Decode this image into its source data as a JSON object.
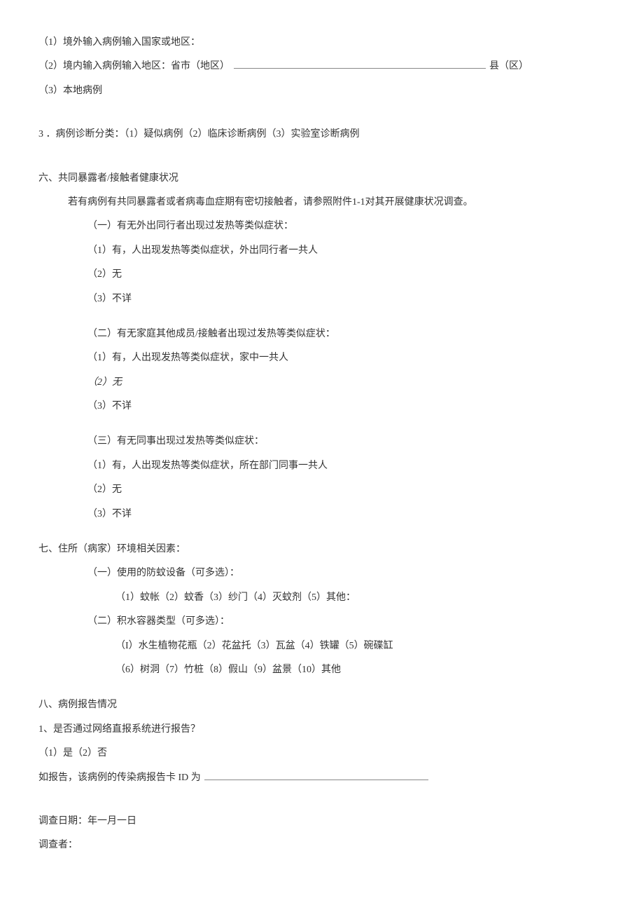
{
  "lines": {
    "l1": "（1）境外输入病例输入国家或地区：",
    "l2a": "（2）境内输入病例输入地区：省市（地区） ",
    "l2b": " 县（区）",
    "l3": "（3）本地病例",
    "l4": "3 ．病例诊断分类：（1）疑似病例（2）临床诊断病例（3）实验室诊断病例",
    "l5": "六、共同暴露者/接触者健康状况",
    "l6": "若有病例有共同暴露者或者病毒血症期有密切接触者，请参照附件1-1对其开展健康状况调查。",
    "l7": "（一）有无外出同行者出现过发热等类似症状：",
    "l8": "（1）有，人出现发热等类似症状，外出同行者一共人",
    "l9": "（2）无",
    "l10": "（3）不详",
    "l11": "（二）有无家庭其他成员/接触者出现过发热等类似症状：",
    "l12": "（1）有，人出现发热等类似症状，家中一共人",
    "l13": "（2）无",
    "l14": "（3）不详",
    "l15": "（三）有无同事出现过发热等类似症状：",
    "l16": "（1）有，人出现发热等类似症状，所在部门同事一共人",
    "l17": "（2）无",
    "l18": "（3）不详",
    "l19": "七、住所（病家）环境相关因素：",
    "l20": "（一）使用的防蚊设备（可多选）：",
    "l21": "（1）蚊帐（2）蚊香（3）纱门（4）灭蚊剂（5）其他：",
    "l22": "（二）积水容器类型（可多选）：",
    "l23": "（I）水生植物花瓶（2）花盆托（3）瓦盆（4）铁罐（5）碗碟缸",
    "l24": "（6）树洞（7）竹桩（8）假山（9）盆景（10）其他",
    "l25": "八、病例报告情况",
    "l26": "1、是否通过网络直报系统进行报告？",
    "l27": "（1）是（2）否",
    "l28": "如报告，该病例的传染病报告卡 ID 为 ",
    "l29": "调查日期：年一月一日",
    "l30": "调查者："
  }
}
